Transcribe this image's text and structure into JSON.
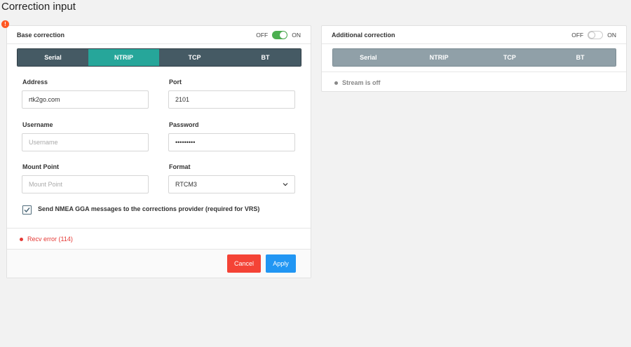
{
  "page": {
    "title": "Correction input"
  },
  "base": {
    "title": "Base correction",
    "toggle": {
      "off_label": "OFF",
      "on_label": "ON",
      "state": "on",
      "color": "#4caf50"
    },
    "alert_icon": "exclamation-icon",
    "tabs": [
      {
        "label": "Serial",
        "active": false
      },
      {
        "label": "NTRIP",
        "active": true
      },
      {
        "label": "TCP",
        "active": false
      },
      {
        "label": "BT",
        "active": false
      }
    ],
    "fields": {
      "address": {
        "label": "Address",
        "value": "rtk2go.com"
      },
      "port": {
        "label": "Port",
        "value": "2101"
      },
      "username": {
        "label": "Username",
        "placeholder": "Username"
      },
      "password": {
        "label": "Password",
        "value": "•••••••••"
      },
      "mount_point": {
        "label": "Mount Point",
        "placeholder": "Mount Point"
      },
      "format": {
        "label": "Format",
        "value": "RTCM3"
      }
    },
    "nmea_checkbox": {
      "label": "Send NMEA GGA messages to the corrections provider (required for VRS)",
      "checked": true
    },
    "status": {
      "text": "Recv error (114)",
      "color": "#e53935"
    },
    "buttons": {
      "cancel": "Cancel",
      "apply": "Apply"
    }
  },
  "additional": {
    "title": "Additional correction",
    "toggle": {
      "off_label": "OFF",
      "on_label": "ON",
      "state": "off"
    },
    "tabs": [
      {
        "label": "Serial"
      },
      {
        "label": "NTRIP"
      },
      {
        "label": "TCP"
      },
      {
        "label": "BT"
      }
    ],
    "status": {
      "text": "Stream is off"
    }
  },
  "colors": {
    "tab_dark": "#455a64",
    "tab_active": "#26a69a",
    "tab_disabled": "#90a0a8",
    "cancel": "#f44336",
    "apply": "#2196f3",
    "alert": "#ff5722"
  }
}
